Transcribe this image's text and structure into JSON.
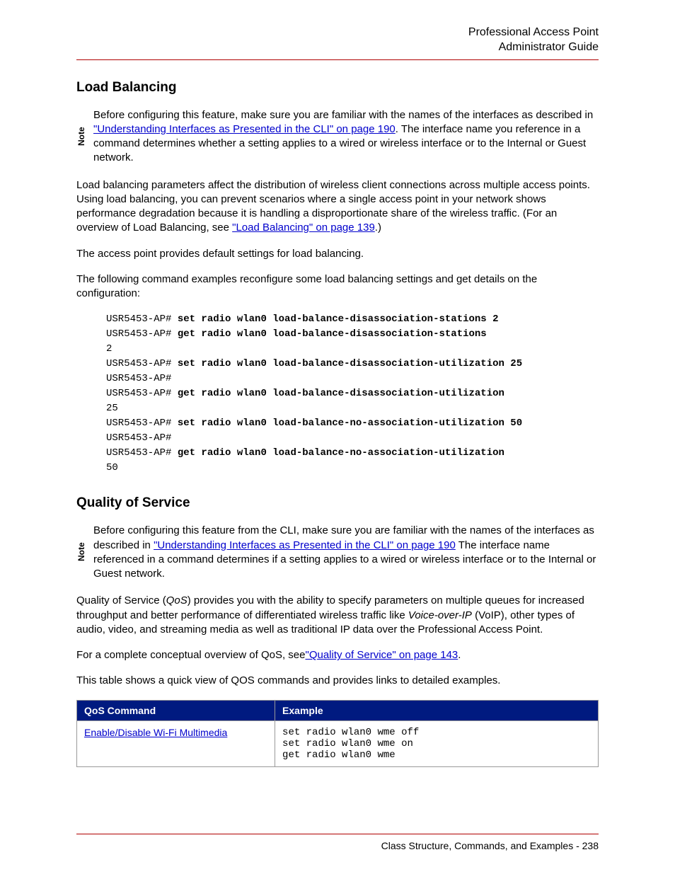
{
  "header": {
    "line1": "Professional Access Point",
    "line2": "Administrator Guide"
  },
  "sections": {
    "load_balancing": {
      "title": "Load Balancing",
      "note_label": "Note",
      "note_pre": "Before configuring this feature, make sure you are familiar with the names of the interfaces as described in ",
      "note_link": "\"Understanding Interfaces as Presented in the CLI\" on page 190",
      "note_post": ". The interface name you reference in a command determines whether a setting applies to a wired or wireless interface or to the Internal or Guest network.",
      "p1_pre": "Load balancing parameters affect the distribution of wireless client connections across multiple access points. Using load balancing, you can prevent scenarios where a single access point in your network shows performance degradation because it is handling a disproportionate share of the wireless traffic. (For an overview of Load Balancing, see ",
      "p1_link": "\"Load Balancing\" on page 139",
      "p1_post": ".)",
      "p2": "The access point provides default settings for load balancing.",
      "p3": "The following command examples reconfigure some load balancing settings and get details on the configuration:",
      "code": {
        "l1p": "USR5453-AP# ",
        "l1b": "set radio wlan0 load-balance-disassociation-stations 2",
        "l2p": "USR5453-AP# ",
        "l2b": "get radio wlan0 load-balance-disassociation-stations",
        "l3": "2",
        "l4p": "USR5453-AP# ",
        "l4b": "set radio wlan0 load-balance-disassociation-utilization 25",
        "l5": "USR5453-AP#",
        "l6p": "USR5453-AP# ",
        "l6b": "get radio wlan0 load-balance-disassociation-utilization",
        "l7": "25",
        "l8p": "USR5453-AP# ",
        "l8b": "set radio wlan0 load-balance-no-association-utilization 50",
        "l9": "USR5453-AP#",
        "l10p": "USR5453-AP# ",
        "l10b": "get radio wlan0 load-balance-no-association-utilization",
        "l11": "50"
      }
    },
    "qos": {
      "title": "Quality of Service",
      "note_label": "Note",
      "note_pre": "Before configuring this feature from the CLI, make sure you are familiar with the names of the interfaces as described in ",
      "note_link": "\"Understanding Interfaces as Presented in the CLI\" on page 190",
      "note_post": " The interface name referenced in a command determines if a setting applies to a wired or wireless interface or to the Internal or Guest network.",
      "p1_a": "Quality of Service (",
      "p1_b": "QoS",
      "p1_c": ") provides you with the ability to specify parameters on multiple queues for increased throughput and better performance of differentiated wireless traffic like ",
      "p1_d": "Voice-over-IP",
      "p1_e": " (VoIP), other types of audio, video, and streaming media as well as traditional IP data over the Professional Access Point.",
      "p2_pre": "For a complete conceptual overview of QoS, see",
      "p2_link": "\"Quality of Service\" on page 143",
      "p2_post": ".",
      "p3": "This table shows a quick view of QOS commands and provides links to detailed examples.",
      "table": {
        "h1": "QoS Command",
        "h2": "Example",
        "r1_cmd": "Enable/Disable Wi-Fi Multimedia",
        "r1_ex": "set radio wlan0 wme off\nset radio wlan0 wme on\nget radio wlan0 wme"
      }
    }
  },
  "footer": {
    "text": "Class Structure, Commands, and Examples - 238"
  }
}
